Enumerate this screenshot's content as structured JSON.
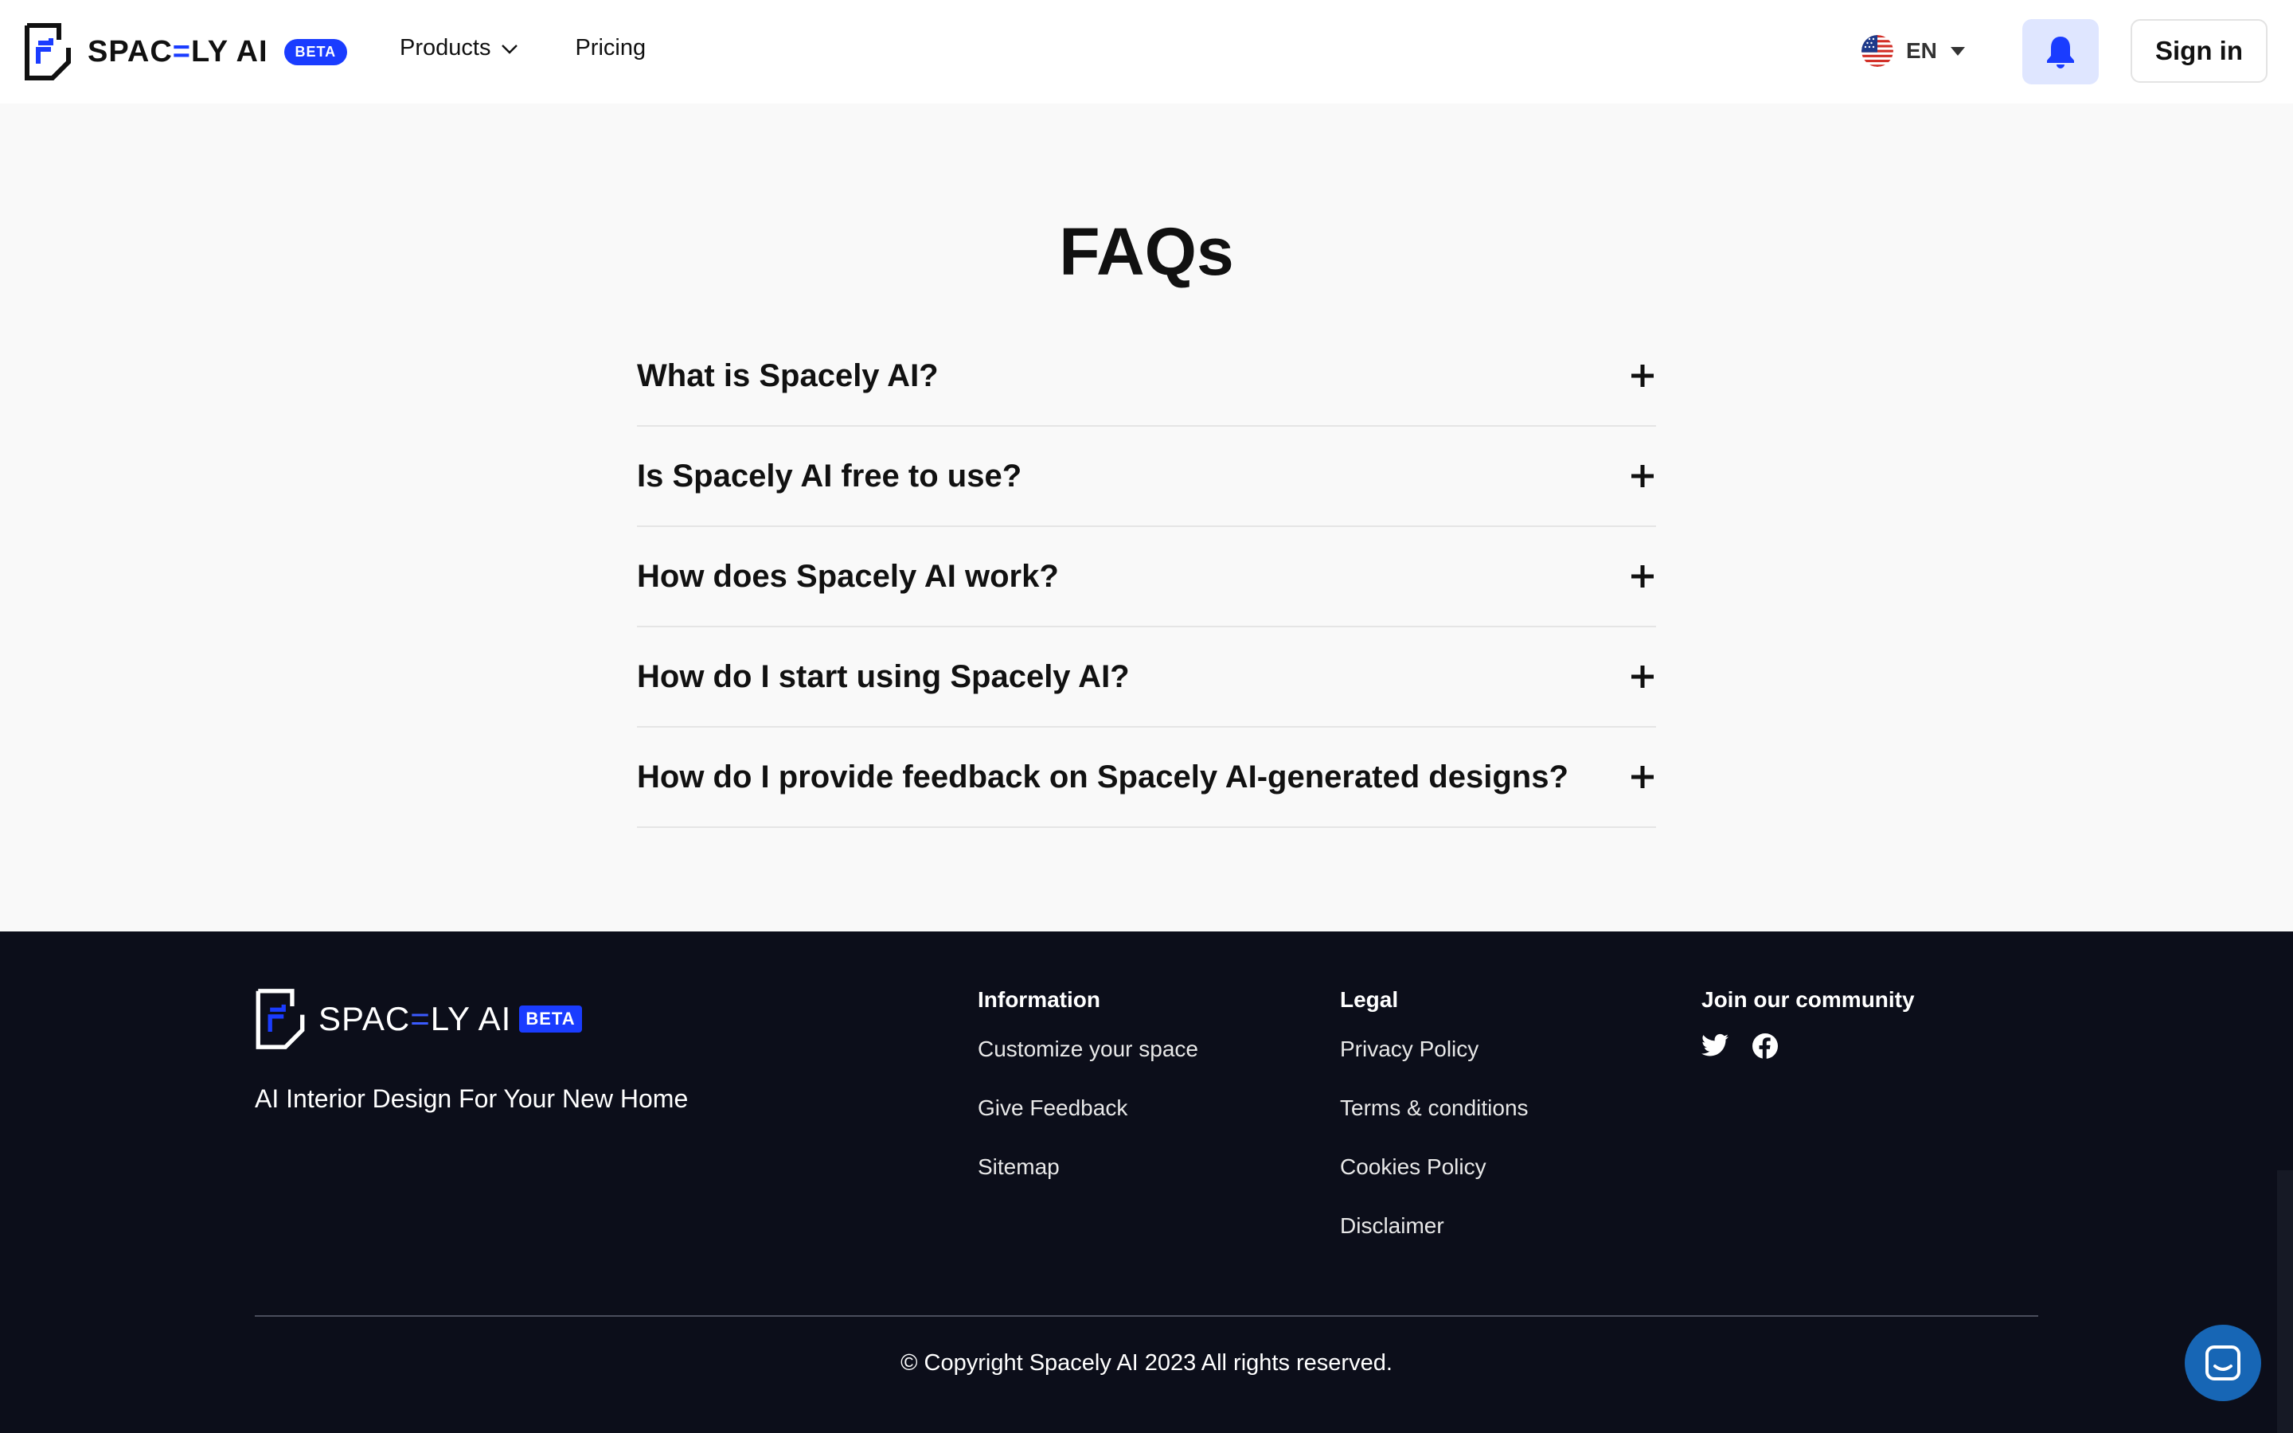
{
  "header": {
    "logo_text_start": "SPAC",
    "logo_text_accent": "=",
    "logo_text_end": "LY AI",
    "beta": "BETA",
    "nav": [
      {
        "label": "Products",
        "icon": "chevron-down-icon"
      },
      {
        "label": "Pricing"
      }
    ],
    "language": {
      "code": "EN",
      "flag": "us-flag-icon"
    },
    "notifications_icon": "bell-icon",
    "sign_in": "Sign in"
  },
  "faq": {
    "title": "FAQs",
    "items": [
      {
        "question": "What is Spacely AI?"
      },
      {
        "question": "Is Spacely AI free to use?"
      },
      {
        "question": "How does Spacely AI work?"
      },
      {
        "question": "How do I start using Spacely AI?"
      },
      {
        "question": "How do I provide feedback on Spacely AI-generated designs?"
      }
    ]
  },
  "footer": {
    "logo_text_start": "SPAC",
    "logo_text_accent": "=",
    "logo_text_end": "LY AI",
    "beta": "BETA",
    "tagline": "AI Interior Design For Your New Home",
    "columns": {
      "information": {
        "title": "Information",
        "links": [
          "Customize your space",
          "Give Feedback",
          "Sitemap"
        ]
      },
      "legal": {
        "title": "Legal",
        "links": [
          "Privacy Policy",
          "Terms & conditions",
          "Cookies Policy",
          "Disclaimer"
        ]
      },
      "community": {
        "title": "Join our community",
        "icons": [
          "twitter-icon",
          "facebook-icon"
        ]
      }
    },
    "copyright": "© Copyright Spacely AI 2023 All rights reserved."
  },
  "chat_icon": "chat-icon",
  "colors": {
    "accent": "#1a3cff",
    "footer_bg": "#0c0e1a",
    "bell_bg": "#dfe6ff",
    "chat_bg": "#1766b5"
  }
}
